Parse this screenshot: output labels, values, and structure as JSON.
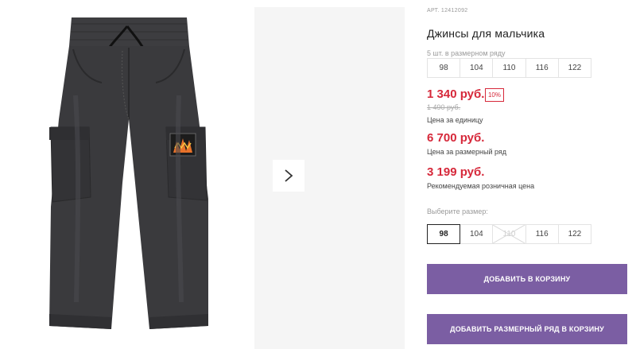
{
  "gallery": {
    "next_arrow_icon": "chevron-right-icon",
    "product_image": "jeans-photo"
  },
  "product": {
    "article": "АРТ. 12412092",
    "title": "Джинсы для мальчика",
    "row_label": "5 шт. в размерном ряду",
    "row_sizes": [
      "98",
      "104",
      "110",
      "116",
      "122"
    ]
  },
  "prices": {
    "unit_price": "1 340 руб.",
    "discount": "10%",
    "old_price": "1 490 руб.",
    "unit_caption": "Цена за единицу",
    "row_price": "6 700 руб.",
    "row_caption": "Цена за размерный ряд",
    "retail_price": "3 199 руб.",
    "retail_caption": "Рекомендуемая розничная цена"
  },
  "size_select": {
    "label": "Выберите размер:",
    "options": [
      {
        "label": "98",
        "state": "selected"
      },
      {
        "label": "104",
        "state": "available"
      },
      {
        "label": "110",
        "state": "disabled"
      },
      {
        "label": "116",
        "state": "available"
      },
      {
        "label": "122",
        "state": "available"
      }
    ]
  },
  "actions": {
    "add_to_cart": "ДОБАВИТЬ В КОРЗИНУ",
    "add_row_to_cart": "ДОБАВИТЬ РАЗМЕРНЫЙ РЯД В КОРЗИНУ"
  },
  "colors": {
    "price_red": "#d6283a",
    "button_purple": "#7b5ea3",
    "denim": "#3a3a3d"
  }
}
